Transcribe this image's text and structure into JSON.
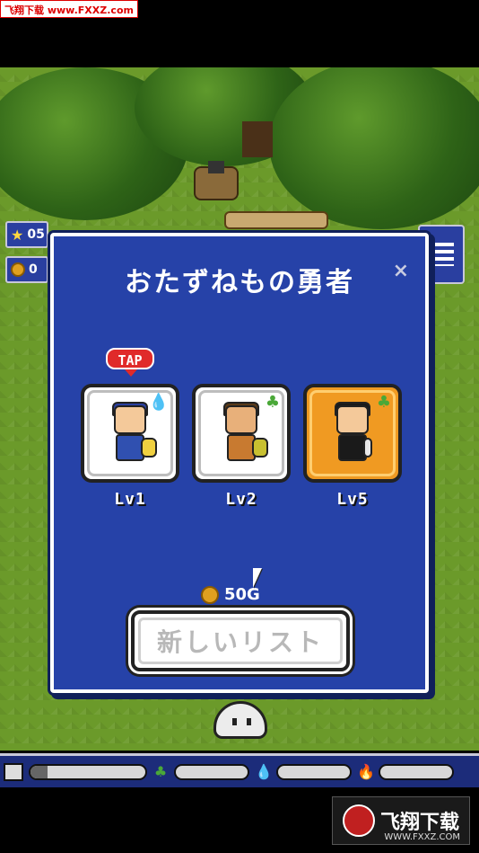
{
  "watermark": {
    "top": "飞翔下载 www.FXXZ.com",
    "bottom_title": "飞翔下载",
    "bottom_url": "WWW.FXXZ.COM"
  },
  "hud": {
    "star_value": "05",
    "coin_value": "0"
  },
  "dialog": {
    "title": "おたずねもの勇者",
    "close_symbol": "×",
    "tap_label": "TAP",
    "heroes": [
      {
        "level": "Lv1",
        "element": "water",
        "element_glyph": "💧",
        "card_style": "white"
      },
      {
        "level": "Lv2",
        "element": "leaf",
        "element_glyph": "♣",
        "card_style": "white"
      },
      {
        "level": "Lv5",
        "element": "leaf",
        "element_glyph": "♣",
        "card_style": "gold"
      }
    ],
    "price": "50G",
    "new_list_label": "新しいリスト"
  },
  "bottom_bar": {
    "icons": [
      "barn-icon",
      "leaf-icon",
      "water-drop-icon",
      "fire-icon"
    ],
    "glyphs": {
      "leaf": "♣",
      "water": "💧",
      "fire": "🔥"
    },
    "bar_levels": [
      0.15,
      0,
      0,
      0
    ]
  },
  "colors": {
    "dialog_bg": "#2642a8",
    "gold_card": "#f09a22",
    "tap_red": "#e02a2a"
  }
}
